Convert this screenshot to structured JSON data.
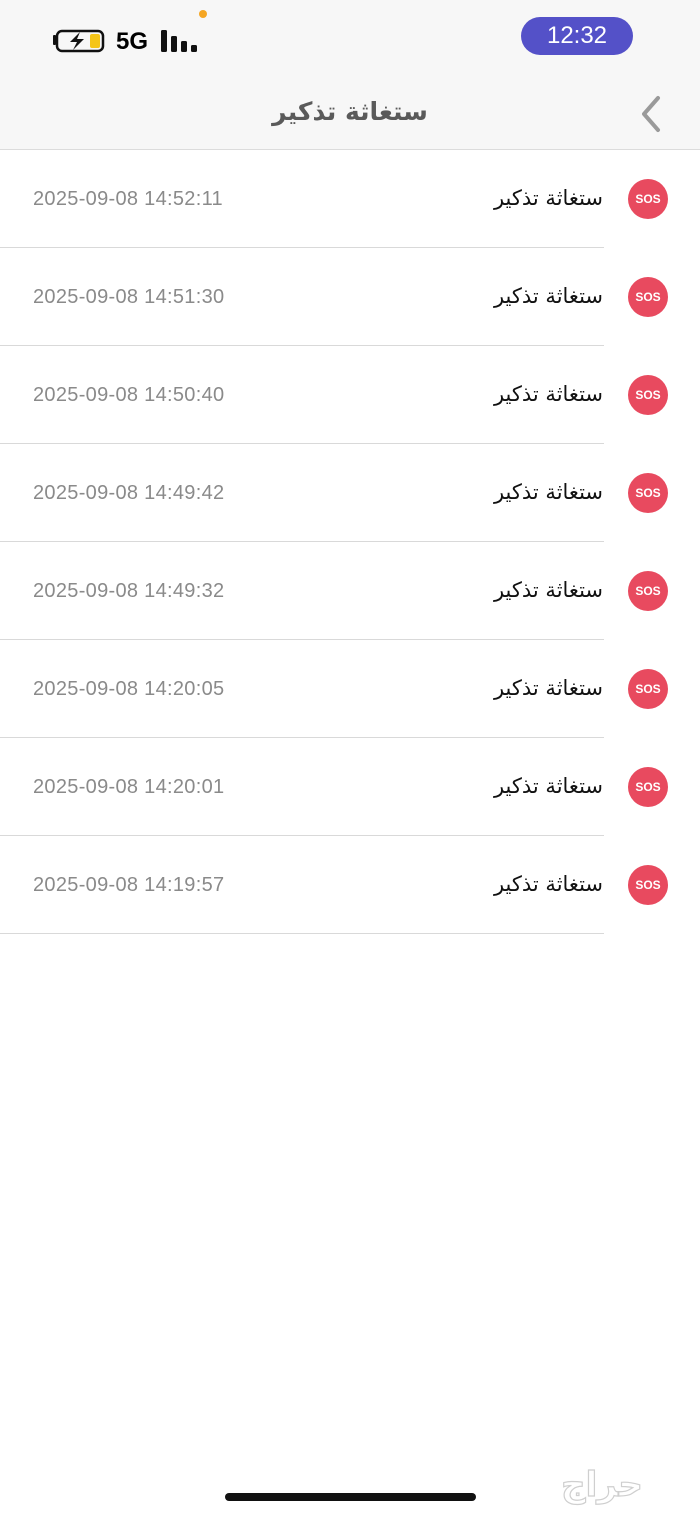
{
  "status_bar": {
    "network": "5G",
    "time": "12:32"
  },
  "nav": {
    "title": "ستغاثة تذكير"
  },
  "alerts": [
    {
      "label": "ستغاثة تذكير",
      "badge": "SOS",
      "time": "2025-09-08 14:52:11"
    },
    {
      "label": "ستغاثة تذكير",
      "badge": "SOS",
      "time": "2025-09-08 14:51:30"
    },
    {
      "label": "ستغاثة تذكير",
      "badge": "SOS",
      "time": "2025-09-08 14:50:40"
    },
    {
      "label": "ستغاثة تذكير",
      "badge": "SOS",
      "time": "2025-09-08 14:49:42"
    },
    {
      "label": "ستغاثة تذكير",
      "badge": "SOS",
      "time": "2025-09-08 14:49:32"
    },
    {
      "label": "ستغاثة تذكير",
      "badge": "SOS",
      "time": "2025-09-08 14:20:05"
    },
    {
      "label": "ستغاثة تذكير",
      "badge": "SOS",
      "time": "2025-09-08 14:20:01"
    },
    {
      "label": "ستغاثة تذكير",
      "badge": "SOS",
      "time": "2025-09-08 14:19:57"
    }
  ],
  "watermark": {
    "text": "حراج"
  },
  "colors": {
    "sos_badge": "#e84a5f",
    "clock_pill": "#5451c8",
    "bar_background": "#f7f7f7"
  }
}
